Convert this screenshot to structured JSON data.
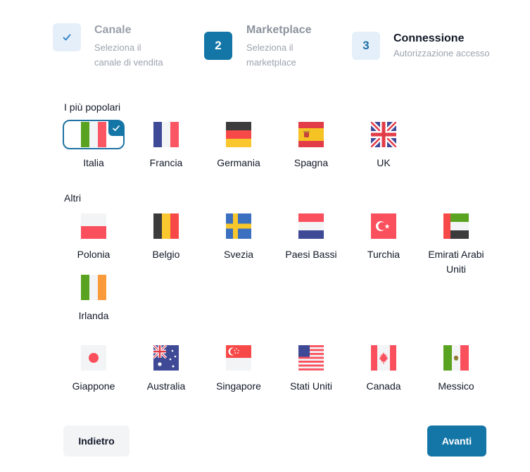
{
  "stepper": {
    "steps": [
      {
        "marker": "",
        "title": "Canale",
        "desc_line1": "Seleziona il",
        "desc_line2": "canale di vendita",
        "state": "done"
      },
      {
        "marker": "2",
        "title": "Marketplace",
        "desc_line1": "Seleziona il",
        "desc_line2": "marketplace",
        "state": "active"
      },
      {
        "marker": "3",
        "title": "Connessione",
        "desc_line1": "Autorizzazione accesso",
        "desc_line2": "",
        "state": "pending"
      }
    ]
  },
  "sections": {
    "popular_label": "I più popolari",
    "others_label": "Altri"
  },
  "popular": [
    {
      "name": "Italia",
      "flag": "flag-italy",
      "selected": true
    },
    {
      "name": "Francia",
      "flag": "flag-france",
      "selected": false
    },
    {
      "name": "Germania",
      "flag": "flag-germany",
      "selected": false
    },
    {
      "name": "Spagna",
      "flag": "flag-spain",
      "selected": false
    },
    {
      "name": "UK",
      "flag": "flag-uk",
      "selected": false
    }
  ],
  "others": [
    {
      "name": "Polonia",
      "flag": "flag-poland"
    },
    {
      "name": "Belgio",
      "flag": "flag-belgium"
    },
    {
      "name": "Svezia",
      "flag": "flag-sweden"
    },
    {
      "name": "Paesi Bassi",
      "flag": "flag-netherlands"
    },
    {
      "name": "Turchia",
      "flag": "flag-turkey"
    },
    {
      "name": "Emirati Arabi Uniti",
      "flag": "flag-uae"
    },
    {
      "name": "Irlanda",
      "flag": "flag-ireland"
    },
    {
      "name": "Giappone",
      "flag": "flag-japan"
    },
    {
      "name": "Australia",
      "flag": "flag-australia"
    },
    {
      "name": "Singapore",
      "flag": "flag-singapore"
    },
    {
      "name": "Stati Uniti",
      "flag": "flag-usa"
    },
    {
      "name": "Canada",
      "flag": "flag-canada"
    },
    {
      "name": "Messico",
      "flag": "flag-mexico"
    }
  ],
  "buttons": {
    "back": "Indietro",
    "next": "Avanti"
  },
  "colors": {
    "accent": "#1476a7",
    "accent_light": "#e4eff9"
  }
}
